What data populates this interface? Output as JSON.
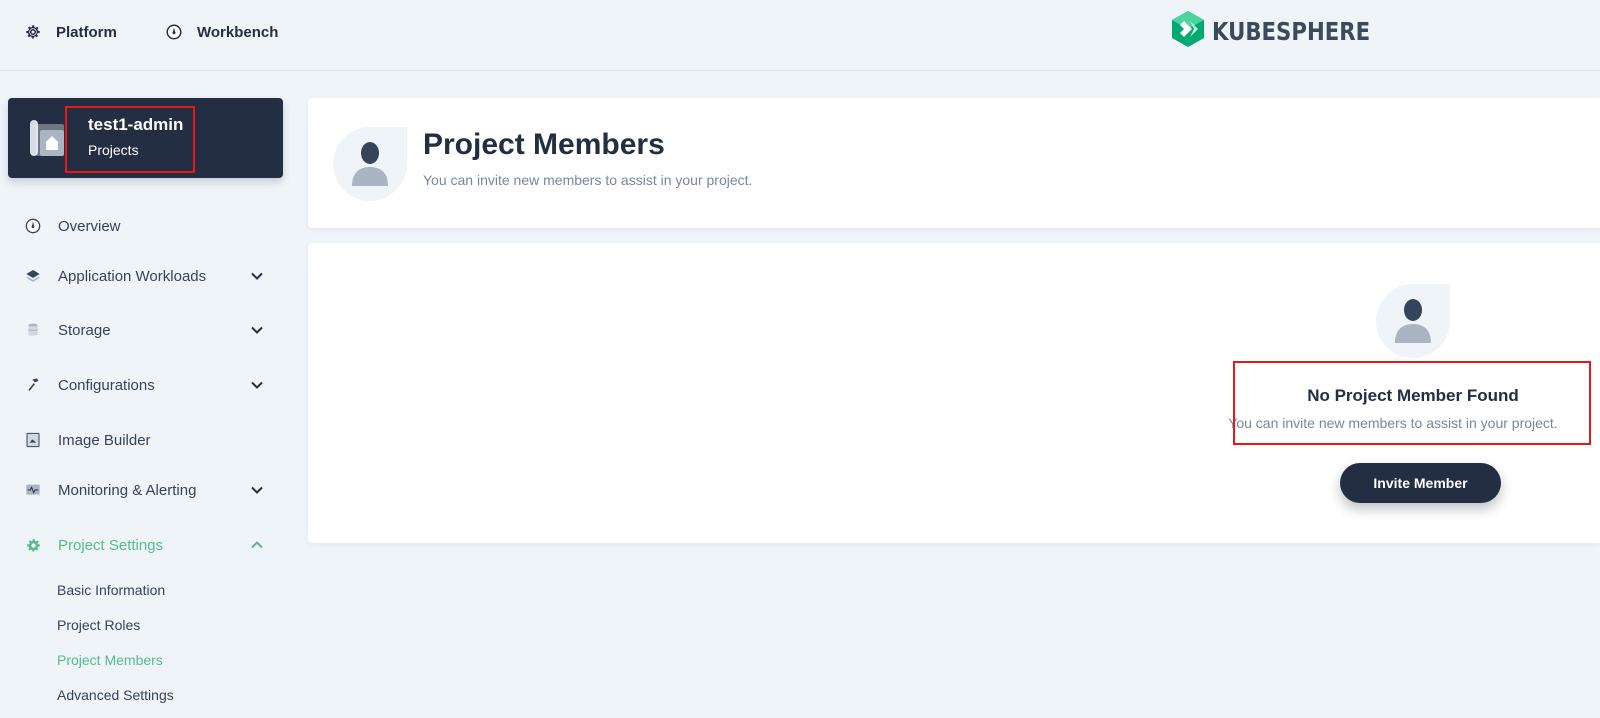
{
  "header": {
    "platform_label": "Platform",
    "workbench_label": "Workbench",
    "brand": "KUBESPHERE",
    "brand_color": "#00a971"
  },
  "project": {
    "name": "test1-admin",
    "type": "Projects"
  },
  "sidebar": {
    "items": [
      {
        "label": "Overview",
        "icon": "dashboard-icon"
      },
      {
        "label": "Application Workloads",
        "icon": "layers-icon"
      },
      {
        "label": "Storage",
        "icon": "database-icon"
      },
      {
        "label": "Configurations",
        "icon": "hammer-icon"
      },
      {
        "label": "Image Builder",
        "icon": "image-builder-icon"
      },
      {
        "label": "Monitoring & Alerting",
        "icon": "monitor-icon"
      },
      {
        "label": "Project Settings",
        "icon": "gear-icon"
      }
    ],
    "settings_subitems": [
      "Basic Information",
      "Project Roles",
      "Project Members",
      "Advanced Settings"
    ]
  },
  "main": {
    "title": "Project Members",
    "description": "You can invite new members to assist in your project.",
    "empty_title": "No Project Member Found",
    "empty_description": "You can invite new members to assist in your project.",
    "invite_label": "Invite Member"
  },
  "colors": {
    "accent": "#55bc8a",
    "dark": "#242e42",
    "highlight": "#e5191c"
  }
}
